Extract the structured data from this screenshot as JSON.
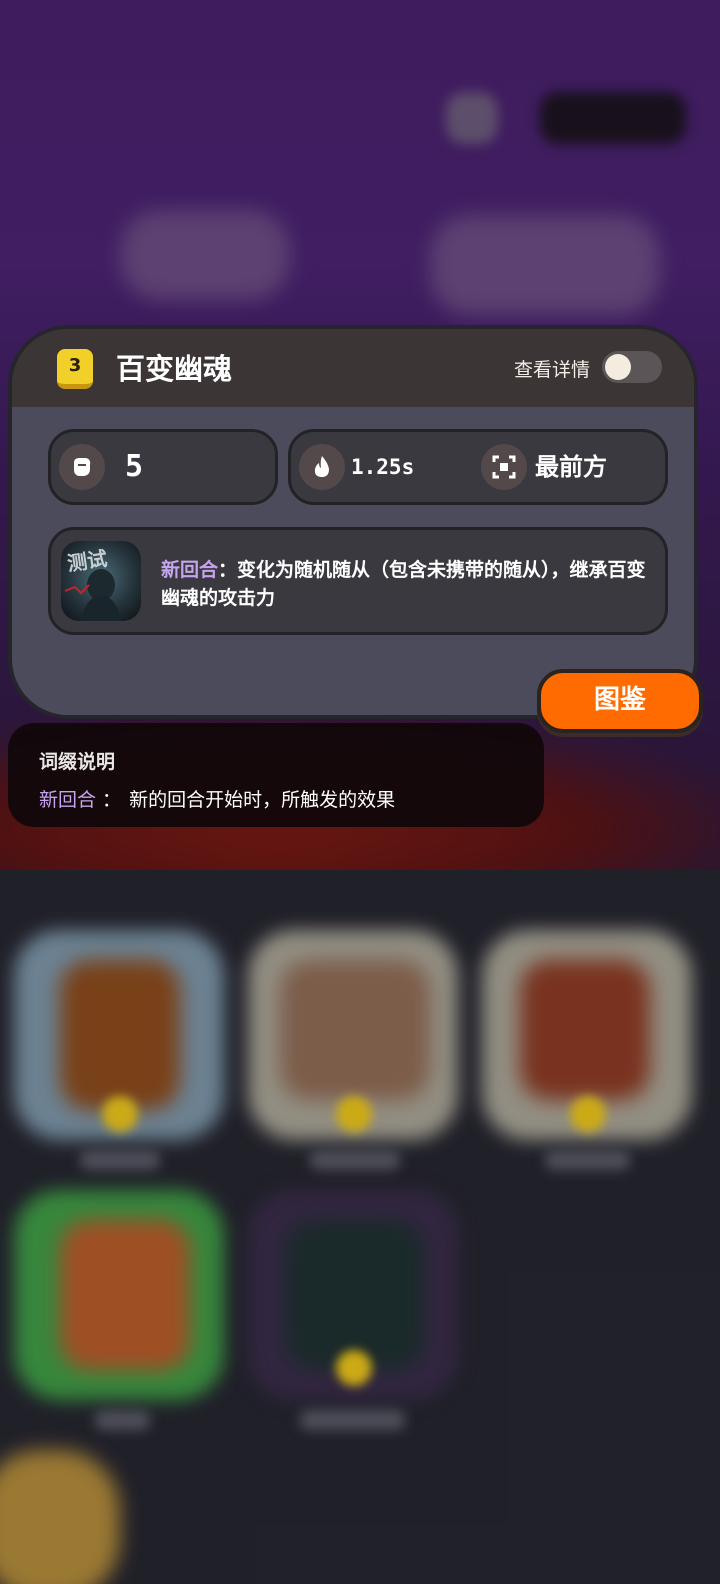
{
  "unit": {
    "level": "3",
    "name": "百变幽魂",
    "detail_label": "查看详情",
    "detail_toggle_on": false
  },
  "stats": {
    "attack": "5",
    "interval": "1.25s",
    "position": "最前方"
  },
  "ability": {
    "keyword": "新回合",
    "separator": "：",
    "description": "变化为随机随从（包含未携带的随从），继承百变幽魂的攻击力",
    "portrait_caption": "测试"
  },
  "codex_button": {
    "label": "图鉴"
  },
  "glossary": {
    "title": "词缀说明",
    "keyword": "新回合",
    "separator": " ：",
    "definition": "新的回合开始时，所触发的效果"
  },
  "colors": {
    "accent_orange": "#ff6b00",
    "keyword_purple": "#c6a4ee",
    "level_gold": "#f3cf2a",
    "panel_bg": "#4c4b5c"
  },
  "icons": {
    "attack": "fist-icon",
    "interval": "flame-icon",
    "position": "target-frame-icon"
  }
}
